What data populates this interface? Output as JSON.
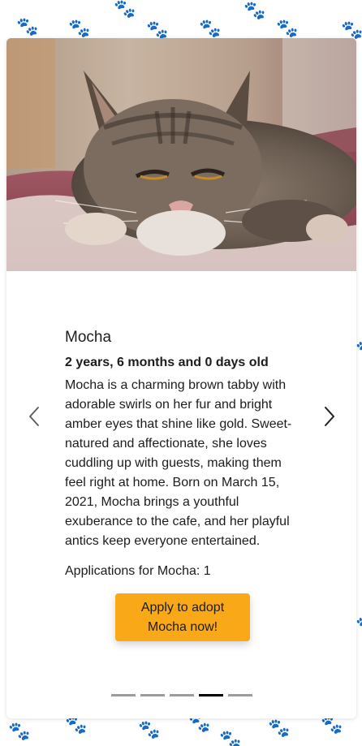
{
  "pet": {
    "name": "Mocha",
    "age": "2 years, 6 months and 0 days old",
    "description": "Mocha is a charming brown tabby with adorable swirls on her fur and bright amber eyes that shine like gold. Sweet-natured and affectionate, she loves cuddling up with guests, making them feel right at home. Born on March 15, 2021, Mocha brings a youthful exuberance to the cafe, and her playful antics keep everyone entertained.",
    "applications": "Applications for Mocha: 1",
    "apply_button_line1": "Apply to adopt",
    "apply_button_line2": "Mocha now!"
  },
  "carousel": {
    "slide_count": 5,
    "active_index": 3,
    "prev_icon": "chevron-left-icon",
    "next_icon": "chevron-right-icon"
  },
  "colors": {
    "accent": "#f9a817",
    "indicator": "#7a7a7a",
    "indicator_active": "#000000",
    "paw": "#dcdcdc"
  }
}
